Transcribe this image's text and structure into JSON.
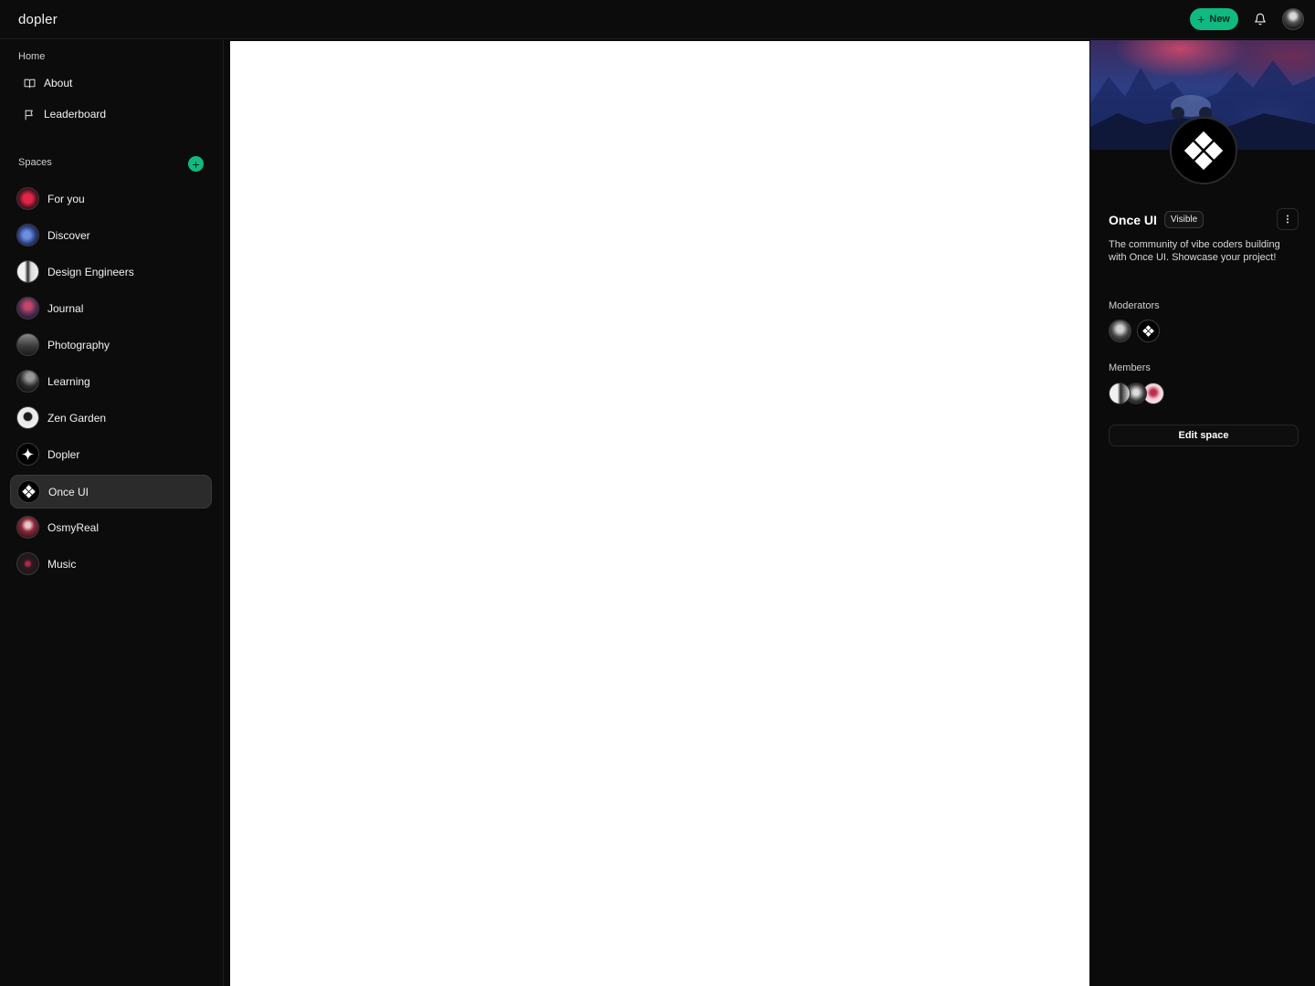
{
  "topbar": {
    "logo": "dopler",
    "new_label": "New"
  },
  "sidebar": {
    "home_label": "Home",
    "links": [
      {
        "label": "About",
        "icon": "book-icon"
      },
      {
        "label": "Leaderboard",
        "icon": "flag-icon"
      }
    ],
    "spaces_label": "Spaces",
    "spaces": [
      {
        "label": "For you"
      },
      {
        "label": "Discover"
      },
      {
        "label": "Design Engineers"
      },
      {
        "label": "Journal"
      },
      {
        "label": "Photography"
      },
      {
        "label": "Learning"
      },
      {
        "label": "Zen Garden"
      },
      {
        "label": "Dopler"
      },
      {
        "label": "Once UI",
        "active": true
      },
      {
        "label": "OsmyReal"
      },
      {
        "label": "Music"
      }
    ]
  },
  "panel": {
    "name": "Once UI",
    "visibility": "Visible",
    "description": "The community of vibe coders building with Once UI. Showcase your project!",
    "moderators_label": "Moderators",
    "members_label": "Members",
    "edit_label": "Edit space"
  },
  "colors": {
    "accent": "#10b981",
    "background": "#0b0b0b",
    "active_item": "#2b2b2b"
  }
}
